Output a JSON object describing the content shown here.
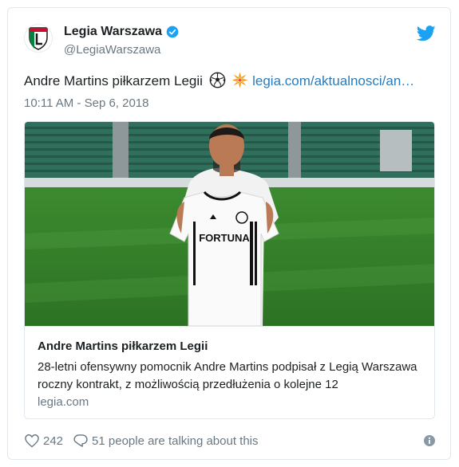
{
  "tweet": {
    "author": {
      "display_name": "Legia Warszawa",
      "handle": "@LegiaWarszawa",
      "verified_icon": "verified-badge-icon",
      "avatar_icon": "legia-crest-logo"
    },
    "text": "Andre Martins piłkarzem Legii",
    "emojis": [
      "soccer-ball-icon",
      "collision-icon"
    ],
    "link_text": "legia.com/aktualnosci/an…",
    "timestamp": "10:11 AM - Sep 6, 2018",
    "card": {
      "image_description": "player-holding-jersey-photo",
      "title": "Andre Martins piłkarzem Legii",
      "description": "28-letni ofensywny pomocnik Andre Martins podpisał z Legią Warszawa roczny kontrakt, z możliwością przedłużenia o kolejne 12",
      "domain": "legia.com",
      "jersey_sponsor": "FORTUNA"
    },
    "footer": {
      "likes": "242",
      "replies_text": "51 people are talking about this"
    },
    "colors": {
      "link": "#2b7bb9",
      "secondary_text": "#697882",
      "twitter_blue": "#1da1f2",
      "like_icon": "#697882"
    }
  }
}
